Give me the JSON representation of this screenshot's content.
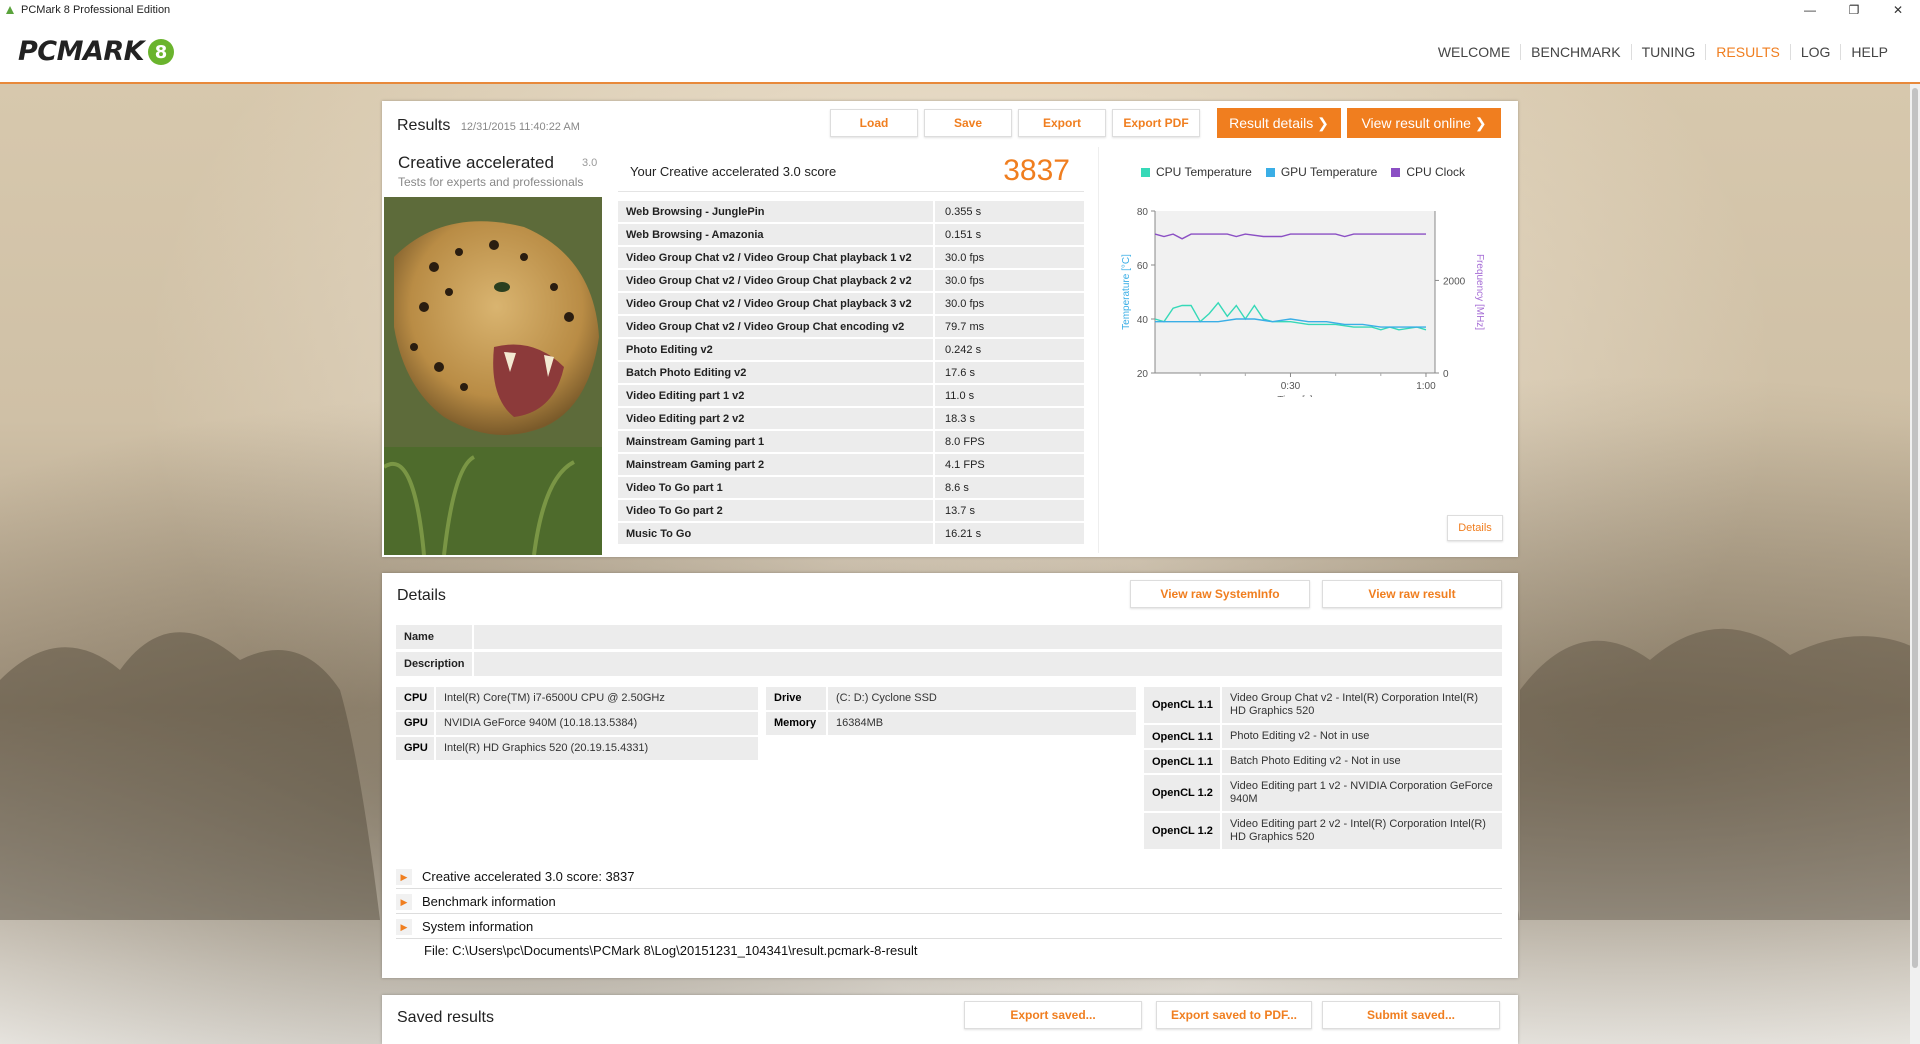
{
  "window": {
    "title": "PCMark 8 Professional Edition",
    "controls": [
      "—",
      "❐",
      "✕"
    ]
  },
  "logo": {
    "word": "PCMARK",
    "digit": "8"
  },
  "nav": [
    {
      "label": "WELCOME",
      "active": false
    },
    {
      "label": "BENCHMARK",
      "active": false
    },
    {
      "label": "TUNING",
      "active": false
    },
    {
      "label": "RESULTS",
      "active": true
    },
    {
      "label": "LOG",
      "active": false
    },
    {
      "label": "HELP",
      "active": false
    }
  ],
  "results": {
    "title": "Results",
    "timestamp": "12/31/2015 11:40:22 AM",
    "buttons": {
      "load": "Load",
      "save": "Save",
      "export": "Export",
      "export_pdf": "Export PDF",
      "result_details": "Result details",
      "view_online": "View result online"
    },
    "test_name": "Creative accelerated",
    "test_version": "3.0",
    "test_description": "Tests for experts and professionals",
    "score_label": "Your Creative accelerated 3.0 score",
    "score_value": "3837",
    "rows": [
      {
        "name": "Web Browsing - JunglePin",
        "value": "0.355 s"
      },
      {
        "name": "Web Browsing - Amazonia",
        "value": "0.151 s"
      },
      {
        "name": "Video Group Chat v2 / Video Group Chat playback 1 v2",
        "value": "30.0 fps"
      },
      {
        "name": "Video Group Chat v2 / Video Group Chat playback 2 v2",
        "value": "30.0 fps"
      },
      {
        "name": "Video Group Chat v2 / Video Group Chat playback 3 v2",
        "value": "30.0 fps"
      },
      {
        "name": "Video Group Chat v2 / Video Group Chat encoding v2",
        "value": "79.7 ms"
      },
      {
        "name": "Photo Editing v2",
        "value": "0.242 s"
      },
      {
        "name": "Batch Photo Editing v2",
        "value": "17.6 s"
      },
      {
        "name": "Video Editing part 1 v2",
        "value": "11.0 s"
      },
      {
        "name": "Video Editing part 2 v2",
        "value": "18.3 s"
      },
      {
        "name": "Mainstream Gaming part 1",
        "value": "8.0 FPS"
      },
      {
        "name": "Mainstream Gaming part 2",
        "value": "4.1 FPS"
      },
      {
        "name": "Video To Go part 1",
        "value": "8.6 s"
      },
      {
        "name": "Video To Go part 2",
        "value": "13.7 s"
      },
      {
        "name": "Music To Go",
        "value": "16.21 s"
      }
    ],
    "details_button": "Details"
  },
  "chart_data": {
    "type": "line",
    "legend": [
      {
        "name": "CPU Temperature",
        "color": "#36d9b8"
      },
      {
        "name": "GPU Temperature",
        "color": "#3aaee6"
      },
      {
        "name": "CPU Clock",
        "color": "#8b4fc4"
      }
    ],
    "xlabel": "Time [s]",
    "ylabel_left": "Temperature [°C]",
    "ylabel_right": "Frequency [MHz]",
    "x_ticks": [
      "0:30",
      "1:00"
    ],
    "y_left_ticks": [
      "20",
      "40",
      "60",
      "80"
    ],
    "y_right_ticks": [
      "0",
      "2000"
    ],
    "y_left_range": [
      20,
      80
    ],
    "y_right_range": [
      0,
      3500
    ],
    "x_range": [
      0,
      62
    ],
    "series": [
      {
        "name": "CPU Temperature",
        "axis": "left",
        "color": "#36d9b8",
        "points": [
          [
            0,
            40
          ],
          [
            2,
            39
          ],
          [
            4,
            44
          ],
          [
            6,
            45
          ],
          [
            8,
            45
          ],
          [
            10,
            39
          ],
          [
            12,
            42
          ],
          [
            14,
            46
          ],
          [
            16,
            41
          ],
          [
            18,
            45
          ],
          [
            20,
            40
          ],
          [
            22,
            45
          ],
          [
            24,
            40
          ],
          [
            26,
            39
          ],
          [
            30,
            39
          ],
          [
            34,
            38
          ],
          [
            40,
            38
          ],
          [
            44,
            37
          ],
          [
            48,
            37
          ],
          [
            50,
            36
          ],
          [
            52,
            37
          ],
          [
            54,
            36
          ],
          [
            58,
            37
          ],
          [
            60,
            36
          ]
        ]
      },
      {
        "name": "GPU Temperature",
        "axis": "left",
        "color": "#3aaee6",
        "points": [
          [
            0,
            39
          ],
          [
            2,
            39
          ],
          [
            6,
            39
          ],
          [
            10,
            39
          ],
          [
            14,
            39
          ],
          [
            18,
            40
          ],
          [
            22,
            40
          ],
          [
            26,
            39
          ],
          [
            30,
            40
          ],
          [
            34,
            39
          ],
          [
            38,
            39
          ],
          [
            42,
            38
          ],
          [
            46,
            38
          ],
          [
            50,
            37
          ],
          [
            54,
            37
          ],
          [
            58,
            37
          ],
          [
            60,
            37
          ]
        ]
      },
      {
        "name": "CPU Clock",
        "axis": "right",
        "color": "#8b4fc4",
        "points": [
          [
            0,
            3000
          ],
          [
            2,
            2950
          ],
          [
            4,
            3000
          ],
          [
            6,
            2900
          ],
          [
            8,
            3000
          ],
          [
            12,
            3000
          ],
          [
            16,
            3000
          ],
          [
            18,
            2950
          ],
          [
            20,
            3000
          ],
          [
            24,
            2950
          ],
          [
            28,
            2950
          ],
          [
            30,
            3000
          ],
          [
            36,
            3000
          ],
          [
            40,
            3000
          ],
          [
            42,
            2950
          ],
          [
            44,
            3000
          ],
          [
            50,
            3000
          ],
          [
            56,
            3000
          ],
          [
            60,
            3000
          ]
        ]
      }
    ]
  },
  "details": {
    "title": "Details",
    "view_raw_sysinfo": "View raw SystemInfo",
    "view_raw_result": "View raw result",
    "name_label": "Name",
    "description_label": "Description",
    "specs_left": [
      {
        "k": "CPU",
        "v": "Intel(R) Core(TM) i7-6500U CPU @ 2.50GHz"
      },
      {
        "k": "GPU",
        "v": "NVIDIA GeForce 940M (10.18.13.5384)"
      },
      {
        "k": "GPU",
        "v": "Intel(R) HD Graphics 520 (20.19.15.4331)"
      }
    ],
    "specs_mid": [
      {
        "k": "Drive",
        "v": "(C: D:) Cyclone SSD"
      },
      {
        "k": "Memory",
        "v": "16384MB"
      }
    ],
    "opencl": [
      {
        "k": "OpenCL 1.1",
        "v": "Video Group Chat v2 - Intel(R) Corporation Intel(R) HD Graphics 520"
      },
      {
        "k": "OpenCL 1.1",
        "v": "Photo Editing v2 - Not in use"
      },
      {
        "k": "OpenCL 1.1",
        "v": "Batch Photo Editing v2 - Not in use"
      },
      {
        "k": "OpenCL 1.2",
        "v": "Video Editing part 1 v2 - NVIDIA Corporation GeForce 940M"
      },
      {
        "k": "OpenCL 1.2",
        "v": "Video Editing part 2 v2 - Intel(R) Corporation Intel(R) HD Graphics 520"
      }
    ],
    "expanders": [
      "Creative accelerated 3.0 score: 3837",
      "Benchmark information",
      "System information"
    ],
    "file": "File: C:\\Users\\pc\\Documents\\PCMark 8\\Log\\20151231_104341\\result.pcmark-8-result"
  },
  "saved": {
    "title": "Saved results",
    "export_saved": "Export saved...",
    "export_saved_pdf": "Export saved to PDF...",
    "submit_saved": "Submit saved..."
  }
}
